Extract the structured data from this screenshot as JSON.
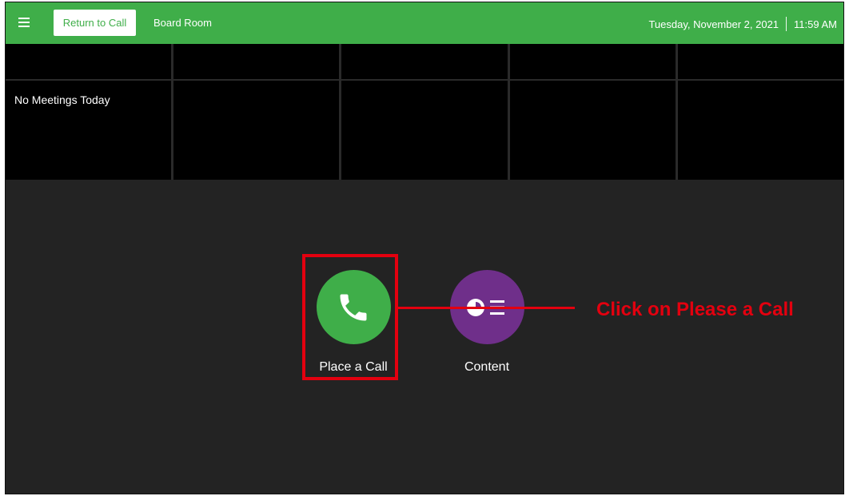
{
  "topbar": {
    "return_label": "Return to Call",
    "room_name": "Board Room",
    "date": "Tuesday, November 2, 2021",
    "time": "11:59 AM",
    "accent_color": "#3fae49"
  },
  "calendar": {
    "empty_text": "No Meetings Today"
  },
  "actions": [
    {
      "label": "Place a Call",
      "icon": "phone-icon",
      "color": "#3fae49"
    },
    {
      "label": "Content",
      "icon": "content-share-icon",
      "color": "#6f2f8a"
    }
  ],
  "annotation": {
    "text": "Click on Please a Call",
    "color": "#e3000f"
  }
}
